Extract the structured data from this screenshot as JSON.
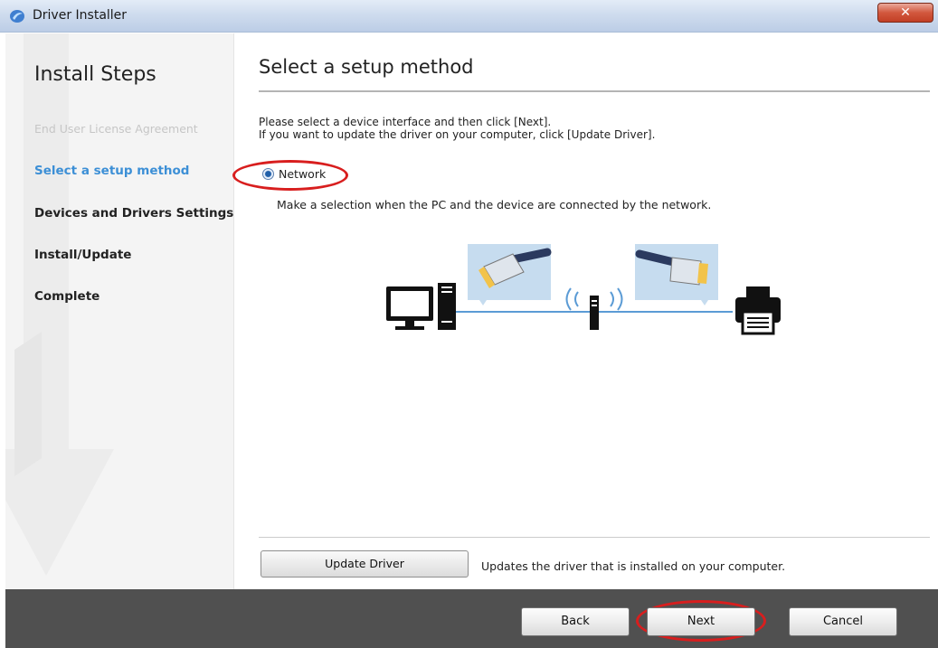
{
  "window": {
    "title": "Driver Installer",
    "close_glyph": "✕"
  },
  "sidebar": {
    "title": "Install Steps",
    "steps": [
      {
        "label": "End User License Agreement",
        "state": "done"
      },
      {
        "label": "Select a setup method",
        "state": "current"
      },
      {
        "label": "Devices and Drivers Settings",
        "state": "pending"
      },
      {
        "label": "Install/Update",
        "state": "pending"
      },
      {
        "label": "Complete",
        "state": "pending"
      }
    ]
  },
  "main": {
    "title": "Select a setup method",
    "intro_line1": "Please select a device interface and then click [Next].",
    "intro_line2": "If you want to update the driver on your computer, click [Update Driver].",
    "option": {
      "label": "Network",
      "selected": true,
      "description": "Make a selection when the PC and the device are connected by the network."
    },
    "diagram": {
      "icons": [
        "computer-icon",
        "ethernet-cable-icon",
        "wireless-router-icon",
        "ethernet-cable-icon",
        "printer-icon"
      ]
    },
    "update_button": "Update Driver",
    "update_description": "Updates the driver that is installed on your computer."
  },
  "footer": {
    "back": "Back",
    "next": "Next",
    "cancel": "Cancel"
  },
  "colors": {
    "current_step": "#3c8fd6",
    "done_step": "#c6c6c6",
    "footer_bg": "#505050",
    "highlight": "#d81e1e",
    "diagram_panel": "#c6dcef"
  }
}
